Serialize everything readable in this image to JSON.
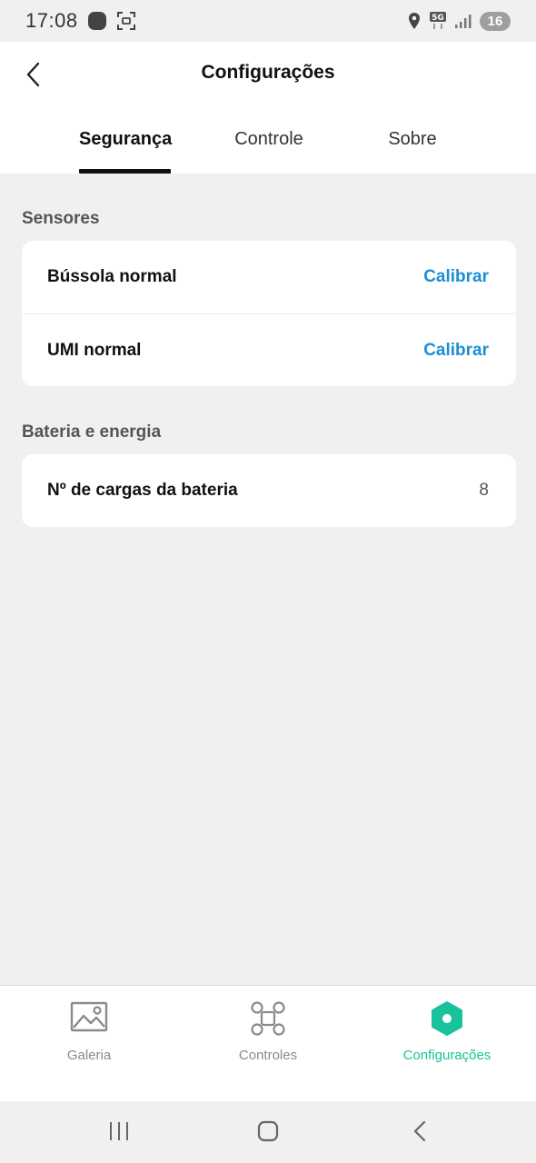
{
  "status_bar": {
    "time": "17:08",
    "network": "5G",
    "battery": "16"
  },
  "header": {
    "title": "Configurações",
    "back_icon": "chevron-left-icon"
  },
  "tabs": [
    {
      "label": "Segurança",
      "active": true
    },
    {
      "label": "Controle",
      "active": false
    },
    {
      "label": "Sobre",
      "active": false
    }
  ],
  "sections": {
    "sensors": {
      "label": "Sensores",
      "rows": [
        {
          "label": "Bússola normal",
          "action": "Calibrar"
        },
        {
          "label": "UMI normal",
          "action": "Calibrar"
        }
      ]
    },
    "battery": {
      "label": "Bateria e energia",
      "rows": [
        {
          "label": "Nº de cargas da bateria",
          "value": "8"
        }
      ]
    }
  },
  "bottom_nav": [
    {
      "label": "Galeria",
      "icon": "gallery-icon",
      "active": false
    },
    {
      "label": "Controles",
      "icon": "drone-icon",
      "active": false
    },
    {
      "label": "Configurações",
      "icon": "settings-hexagon-icon",
      "active": true
    }
  ],
  "colors": {
    "accent_link": "#1b8ed6",
    "active_nav": "#19c29a",
    "background": "#f0f0f0"
  }
}
